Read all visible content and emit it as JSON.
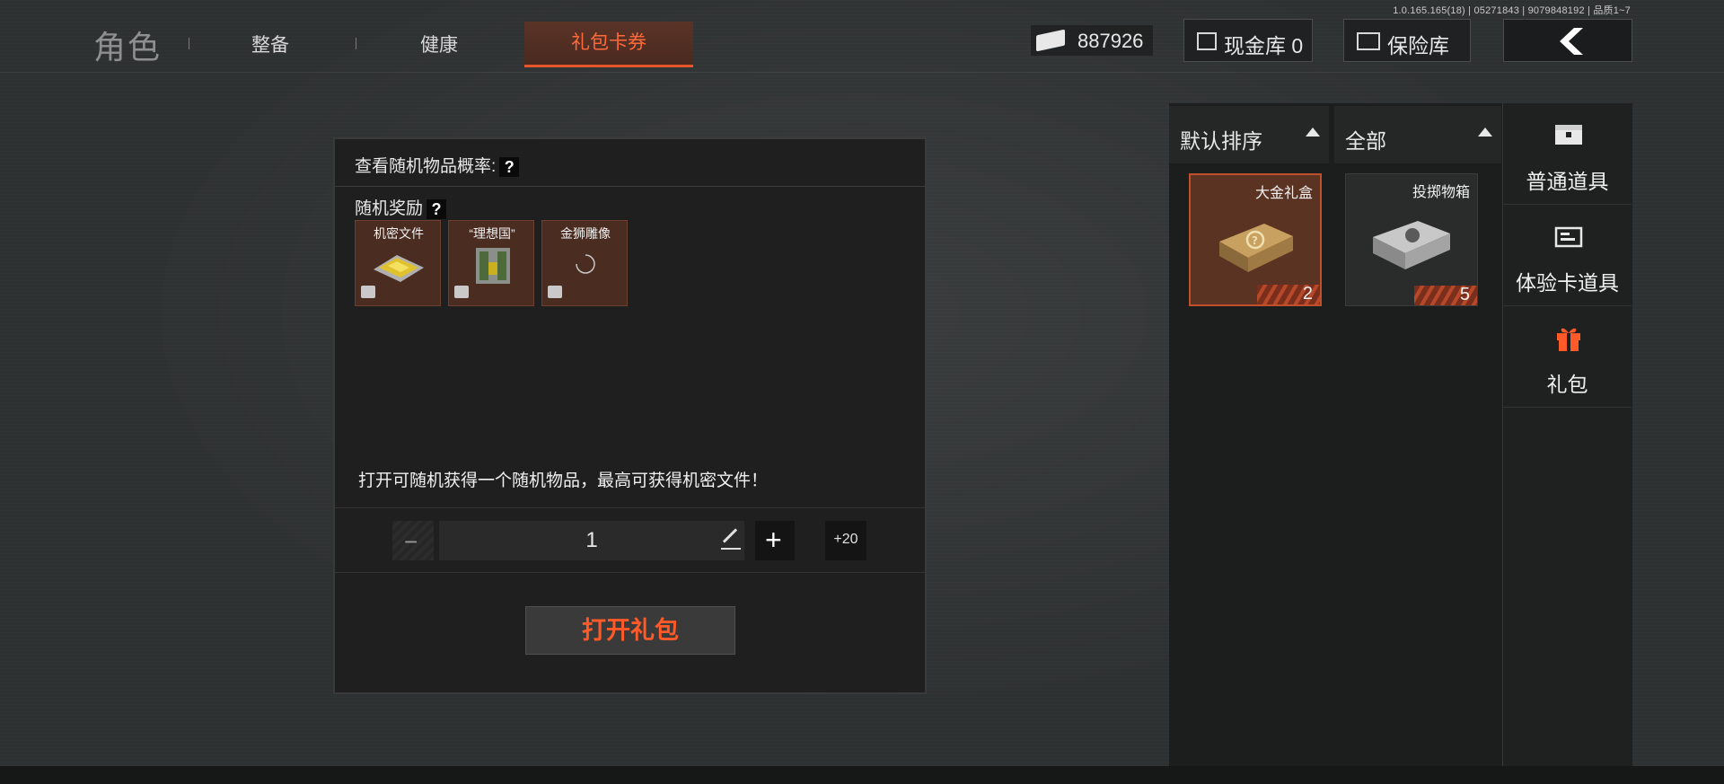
{
  "version": "1.0.165.165(18) | 05271843 | 9079848192 | 品质1~7",
  "nav": {
    "title": "角色",
    "tabs": [
      "整备",
      "健康",
      "礼包卡券"
    ],
    "active_tab": "礼包卡券"
  },
  "header": {
    "currency_value": "887926",
    "cash_vault_label": "现金库 0",
    "safe_label": "保险库",
    "back_icon": "chevron-left-icon"
  },
  "dialog": {
    "probability_label": "查看随机物品概率:",
    "help_mark": "?",
    "random_reward_label": "随机奖励",
    "rewards": [
      {
        "name": "机密文件",
        "icon": "gold-document-icon"
      },
      {
        "name": "“理想国”",
        "icon": "green-crate-icon"
      },
      {
        "name": "金狮雕像",
        "icon": "loading-spinner-icon"
      }
    ],
    "description": "打开可随机获得一个随机物品，最高可获得机密文件！",
    "quantity": "1",
    "minus_label": "−",
    "plus_label": "+",
    "plus20_label": "+20",
    "open_button": "打开礼包"
  },
  "right_panel": {
    "sort_label": "默认排序",
    "filter_label": "全部",
    "items": [
      {
        "name": "大金礼盒",
        "count": "2",
        "selected": true
      },
      {
        "name": "投掷物箱",
        "count": "5",
        "selected": false
      }
    ]
  },
  "categories": [
    {
      "label": "普通道具",
      "icon": "chest-icon"
    },
    {
      "label": "体验卡道具",
      "icon": "card-icon"
    },
    {
      "label": "礼包",
      "icon": "gift-icon"
    }
  ],
  "colors": {
    "accent": "#ff5a28",
    "tab_active_bg": "#4a2a20",
    "selected_item_bg": "#5b3323"
  }
}
